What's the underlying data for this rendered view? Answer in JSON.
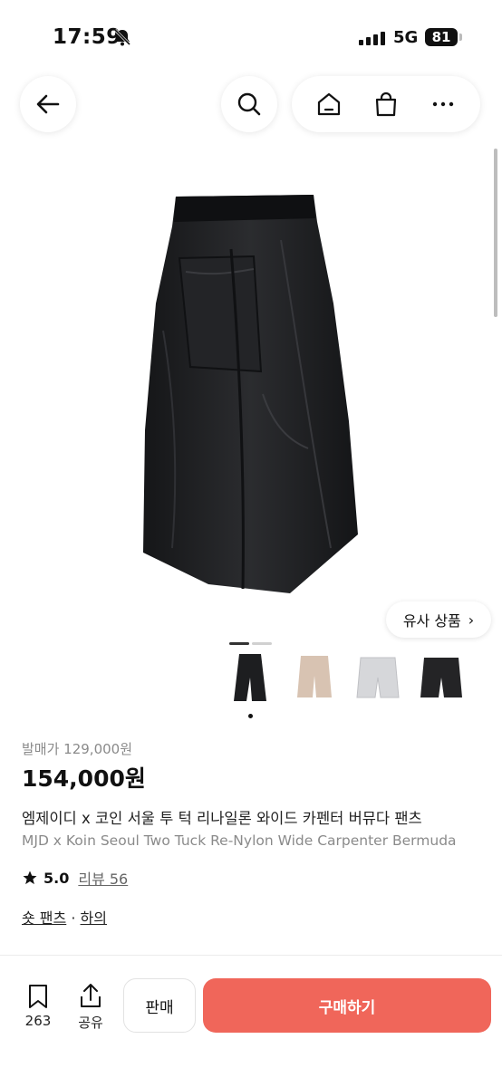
{
  "status_bar": {
    "time": "17:59",
    "network": "5G",
    "battery": "81"
  },
  "nav": {
    "icons": [
      "back-arrow-icon",
      "search-icon",
      "home-icon",
      "shopping-bag-icon",
      "more-icon"
    ]
  },
  "similar_products": {
    "label": "유사 상품",
    "arrow": "›"
  },
  "product": {
    "original_price": "발매가 129,000원",
    "price": "154,000원",
    "title_kr": "엠제이디 x 코인 서울 투 턱 리나일론 와이드 카펜터 버뮤다 팬츠",
    "title_en": "MJD x Koin Seoul Two Tuck Re-Nylon Wide Carpenter Bermuda",
    "rating": "5.0",
    "review_label": "리뷰 56",
    "category_1": "숏 팬츠",
    "category_sep": "·",
    "category_2": "하의",
    "thumbnail_colors": [
      "#1d1e20",
      "#d8c3b2",
      "#d6d7da",
      "#242426"
    ]
  },
  "bottom_bar": {
    "bookmark_count": "263",
    "share_label": "공유",
    "sell_label": "판매",
    "buy_label": "구매하기"
  },
  "colors": {
    "accent": "#f0665a"
  }
}
